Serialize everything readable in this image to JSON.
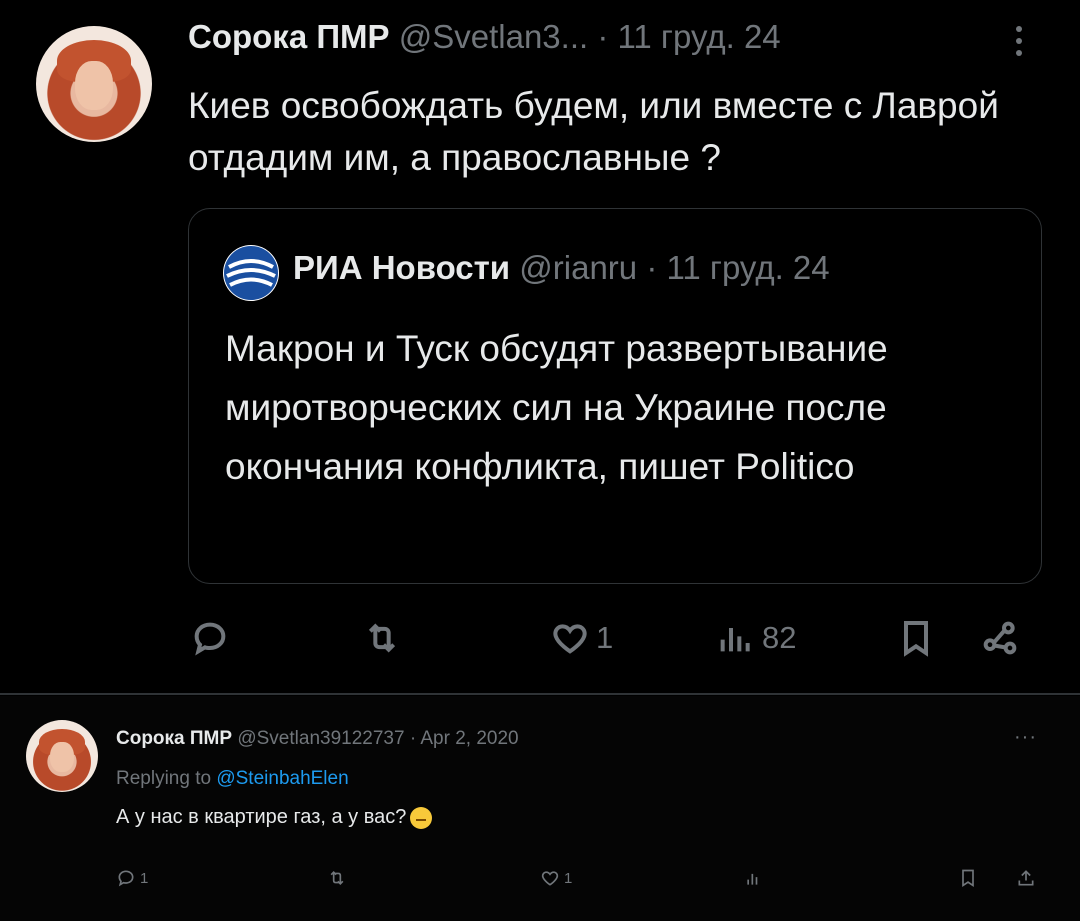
{
  "tweet": {
    "author_name": "Сорока ПМР",
    "author_handle": "@Svetlan3...",
    "date": "· 11 груд. 24",
    "text": "Киев освобождать будем, или вместе с Лаврой отдадим им, а православные ?",
    "quote": {
      "author_name": "РИА Новости",
      "author_handle": "@rianru",
      "date": "· 11 груд. 24",
      "text": "Макрон и Туск обсудят развертывание миротворческих сил на Украине после окончания конфликта, пишет Politico"
    },
    "actions": {
      "reply_icon": "reply-icon",
      "retweet_icon": "retweet-icon",
      "like_icon": "like-icon",
      "like_count": "1",
      "views_icon": "views-icon",
      "views_count": "82",
      "bookmark_icon": "bookmark-icon",
      "share_icon": "share-icon"
    }
  },
  "screenshot_tweet": {
    "author_name": "Сорока ПМР",
    "author_handle": "@Svetlan39122737",
    "date": "· Apr 2, 2020",
    "replying_prefix": "Replying to",
    "replying_to": "@SteinbahElen",
    "text": "А у нас в квартире газ, а у вас?",
    "emoji": "thinking-face-emoji",
    "more": "···",
    "actions": {
      "reply_count": "1",
      "like_count": "1"
    }
  },
  "colors": {
    "background": "#000000",
    "text": "#e7e9ea",
    "muted": "#71767b",
    "border": "#2f3336",
    "link": "#1d9bf0"
  }
}
